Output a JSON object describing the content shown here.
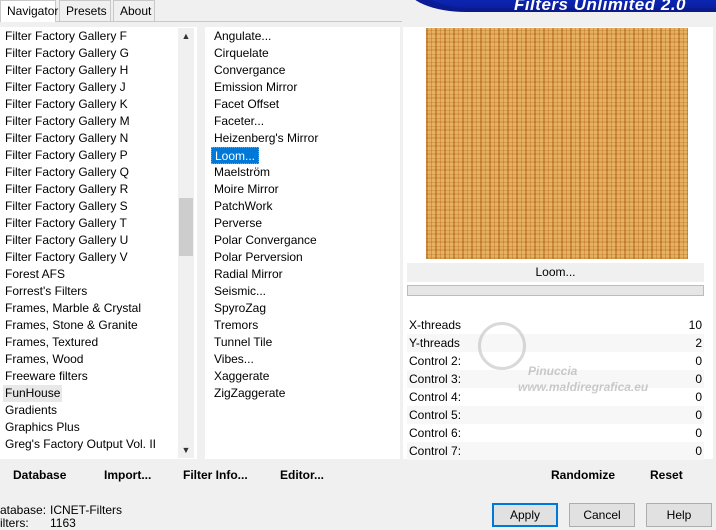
{
  "tabs": [
    {
      "label": "Navigator",
      "active": true
    },
    {
      "label": "Presets",
      "active": false
    },
    {
      "label": "About",
      "active": false
    }
  ],
  "banner": {
    "title": "Filters Unlimited 2.0"
  },
  "categories": {
    "items": [
      "Filter Factory Gallery F",
      "Filter Factory Gallery G",
      "Filter Factory Gallery H",
      "Filter Factory Gallery J",
      "Filter Factory Gallery K",
      "Filter Factory Gallery M",
      "Filter Factory Gallery N",
      "Filter Factory Gallery P",
      "Filter Factory Gallery Q",
      "Filter Factory Gallery R",
      "Filter Factory Gallery S",
      "Filter Factory Gallery T",
      "Filter Factory Gallery U",
      "Filter Factory Gallery V",
      "Forest AFS",
      "Forrest's Filters",
      "Frames, Marble & Crystal",
      "Frames, Stone & Granite",
      "Frames, Textured",
      "Frames, Wood",
      "Freeware filters",
      "FunHouse",
      "Gradients",
      "Graphics Plus",
      "Greg's Factory Output Vol. II"
    ],
    "selected": "FunHouse"
  },
  "filters": {
    "items": [
      "Angulate...",
      "Cirquelate",
      "Convergance",
      "Emission Mirror",
      "Facet Offset",
      "Faceter...",
      "Heizenberg's Mirror",
      "Loom...",
      "Maelström",
      "Moire Mirror",
      "PatchWork",
      "Perverse",
      "Polar Convergance",
      "Polar Perversion",
      "Radial Mirror",
      "Seismic...",
      "SpyroZag",
      "Tremors",
      "Tunnel Tile",
      "Vibes...",
      "Xaggerate",
      "ZigZaggerate"
    ],
    "selected": "Loom..."
  },
  "preview": {
    "filter_name": "Loom...",
    "texture_color": "#dca04e"
  },
  "controls": [
    {
      "label": "X-threads",
      "value": "10"
    },
    {
      "label": "Y-threads",
      "value": "2"
    },
    {
      "label": "Control 2:",
      "value": "0"
    },
    {
      "label": "Control 3:",
      "value": "0"
    },
    {
      "label": "Control 4:",
      "value": "0"
    },
    {
      "label": "Control 5:",
      "value": "0"
    },
    {
      "label": "Control 6:",
      "value": "0"
    },
    {
      "label": "Control 7:",
      "value": "0"
    }
  ],
  "toolbar": {
    "database": "Database",
    "import": "Import...",
    "filter_info": "Filter Info...",
    "editor": "Editor...",
    "randomize": "Randomize",
    "reset": "Reset"
  },
  "info": {
    "database_label": "atabase:",
    "database_value": "ICNET-Filters",
    "filters_label": "ilters:",
    "filters_value": "1163"
  },
  "dialog": {
    "apply": "Apply",
    "cancel": "Cancel",
    "help": "Help"
  },
  "watermark": {
    "line1": "Pinuccia",
    "line2": "www.maldiregrafica.eu"
  }
}
